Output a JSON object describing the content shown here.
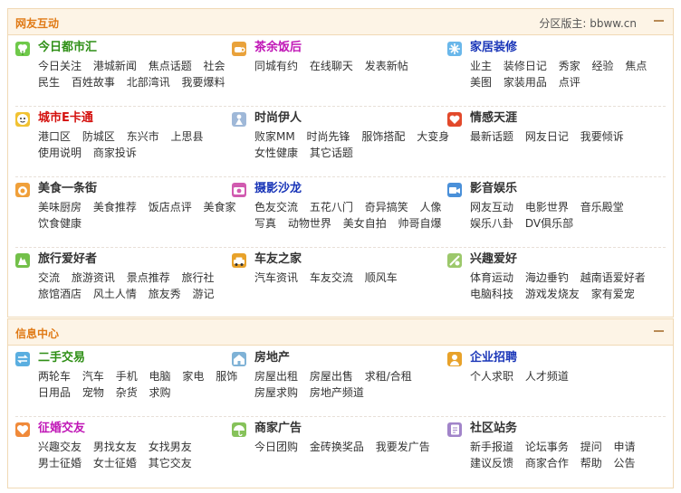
{
  "panels": [
    {
      "title": "网友互动",
      "moderator": "分区版主:",
      "moderator_name": "bbww.cn",
      "rows": [
        [
          {
            "name": "今日都市汇",
            "color": "#2f8f16",
            "icon": "clover-icon",
            "iconColor": "#6fc94a",
            "links": [
              "今日关注",
              "港城新闻",
              "焦点话题",
              "社会",
              "民生",
              "百姓故事",
              "北部湾讯",
              "我要爆料"
            ]
          },
          {
            "name": "茶余饭后",
            "color": "#c016b6",
            "icon": "teacup-icon",
            "iconColor": "#e9a23b",
            "links": [
              "同城有约",
              "在线聊天",
              "发表新帖"
            ]
          },
          {
            "name": "家居装修",
            "color": "#1a36b8",
            "icon": "snowflake-icon",
            "iconColor": "#6ab7ea",
            "links": [
              "业主",
              "装修日记",
              "秀家",
              "经验",
              "焦点",
              "美图",
              "家装用品",
              "点评"
            ]
          }
        ],
        [
          {
            "name": "城市E卡通",
            "color": "#d4110e",
            "icon": "face-icon",
            "iconColor": "#f1c232",
            "links": [
              "港口区",
              "防城区",
              "东兴市",
              "上思县",
              "使用说明",
              "商家投诉"
            ]
          },
          {
            "name": "时尚伊人",
            "color": "#333333",
            "icon": "fashion-icon",
            "iconColor": "#9fb8d8",
            "links": [
              "败家MM",
              "时尚先锋",
              "服饰搭配",
              "大变身",
              "女性健康",
              "其它话题"
            ]
          },
          {
            "name": "情感天涯",
            "color": "#333333",
            "icon": "heart-box-icon",
            "iconColor": "#e2492b",
            "links": [
              "最新话题",
              "网友日记",
              "我要倾诉"
            ]
          }
        ],
        [
          {
            "name": "美食一条街",
            "color": "#333333",
            "icon": "food-icon",
            "iconColor": "#f0a03a",
            "links": [
              "美味厨房",
              "美食推荐",
              "饭店点评",
              "美食家",
              "饮食健康"
            ]
          },
          {
            "name": "摄影沙龙",
            "color": "#1a36b8",
            "icon": "camera-icon",
            "iconColor": "#d15bb0",
            "links": [
              "色友交流",
              "五花八门",
              "奇异搞笑",
              "人像",
              "写真",
              "动物世界",
              "美女自拍",
              "帅哥自爆"
            ]
          },
          {
            "name": "影音娱乐",
            "color": "#333333",
            "icon": "video-icon",
            "iconColor": "#4a90d9",
            "links": [
              "网友互动",
              "电影世界",
              "音乐殿堂",
              "娱乐八卦",
              "DV俱乐部"
            ]
          }
        ],
        [
          {
            "name": "旅行爱好者",
            "color": "#333333",
            "icon": "travel-icon",
            "iconColor": "#73c04a",
            "links": [
              "交流",
              "旅游资讯",
              "景点推荐",
              "旅行社",
              "旅馆酒店",
              "风土人情",
              "旅友秀",
              "游记"
            ]
          },
          {
            "name": "车友之家",
            "color": "#333333",
            "icon": "car-icon",
            "iconColor": "#e8a22a",
            "links": [
              "汽车资讯",
              "车友交流",
              "顺风车"
            ]
          },
          {
            "name": "兴趣爱好",
            "color": "#333333",
            "icon": "hobby-icon",
            "iconColor": "#9cc86b",
            "links": [
              "体育运动",
              "海边垂钓",
              "越南语爱好者",
              "电脑科技",
              "游戏发烧友",
              "家有爱宠"
            ]
          }
        ]
      ]
    },
    {
      "title": "信息中心",
      "rows": [
        [
          {
            "name": "二手交易",
            "color": "#2f8f16",
            "icon": "trade-icon",
            "iconColor": "#5aaee0",
            "links": [
              "两轮车",
              "汽车",
              "手机",
              "电脑",
              "家电",
              "服饰",
              "日用品",
              "宠物",
              "杂货",
              "求购"
            ]
          },
          {
            "name": "房地产",
            "color": "#333333",
            "icon": "house-icon",
            "iconColor": "#7fb2d6",
            "links": [
              "房屋出租",
              "房屋出售",
              "求租/合租",
              "房屋求购",
              "房地产频道"
            ]
          },
          {
            "name": "企业招聘",
            "color": "#1a36b8",
            "icon": "person-icon",
            "iconColor": "#e8a22a",
            "links": [
              "个人求职",
              "人才频道"
            ]
          }
        ],
        [
          {
            "name": "征婚交友",
            "color": "#c016b6",
            "icon": "love-icon",
            "iconColor": "#f08a3a",
            "links": [
              "兴趣交友",
              "男找女友",
              "女找男友",
              "男士征婚",
              "女士征婚",
              "其它交友"
            ]
          },
          {
            "name": "商家广告",
            "color": "#333333",
            "icon": "umbrella-icon",
            "iconColor": "#86c25a",
            "links": [
              "今日团购",
              "金砖换奖品",
              "我要发广告"
            ]
          },
          {
            "name": "社区站务",
            "color": "#333333",
            "icon": "notebook-icon",
            "iconColor": "#a184c9",
            "links": [
              "新手报道",
              "论坛事务",
              "提问",
              "申请",
              "建议反馈",
              "商家合作",
              "帮助",
              "公告"
            ]
          }
        ]
      ]
    }
  ]
}
